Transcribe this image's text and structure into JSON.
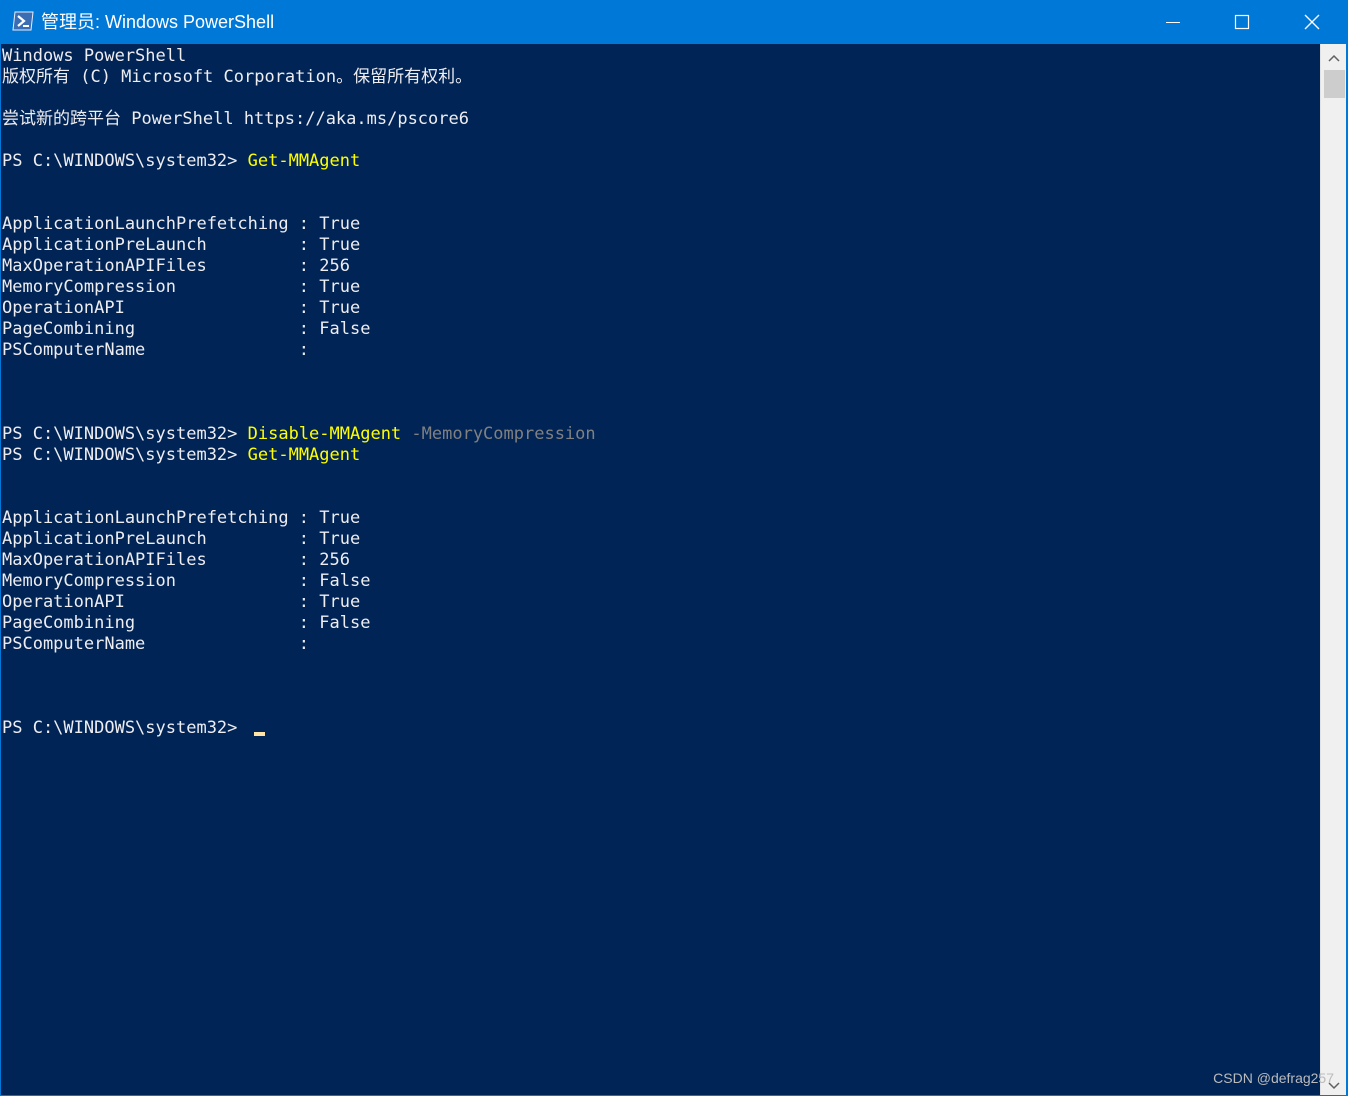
{
  "window": {
    "title": "管理员: Windows PowerShell",
    "icon": "powershell-icon",
    "controls": [
      "minimize-icon",
      "maximize-icon",
      "close-icon"
    ]
  },
  "console": {
    "header": [
      "Windows PowerShell",
      "版权所有 (C) Microsoft Corporation。保留所有权利。",
      "",
      "尝试新的跨平台 PowerShell https://aka.ms/pscore6"
    ],
    "prompt": "PS C:\\WINDOWS\\system32> ",
    "cmd1": "Get-MMAgent",
    "output1": [
      "ApplicationLaunchPrefetching : True",
      "ApplicationPreLaunch         : True",
      "MaxOperationAPIFiles         : 256",
      "MemoryCompression            : True",
      "OperationAPI                 : True",
      "PageCombining                : False",
      "PSComputerName               :"
    ],
    "cmd2": "Disable-MMAgent",
    "cmd2_param": " -MemoryCompression",
    "cmd3": "Get-MMAgent",
    "output2": [
      "ApplicationLaunchPrefetching : True",
      "ApplicationPreLaunch         : True",
      "MaxOperationAPIFiles         : 256",
      "MemoryCompression            : False",
      "OperationAPI                 : True",
      "PageCombining                : False",
      "PSComputerName               :"
    ]
  },
  "colors": {
    "background": "#012456",
    "foreground": "#eeedf0",
    "command": "#ffff00",
    "parameter": "#808080",
    "titlebar": "#0078d7"
  },
  "watermark": "CSDN @defrag257"
}
